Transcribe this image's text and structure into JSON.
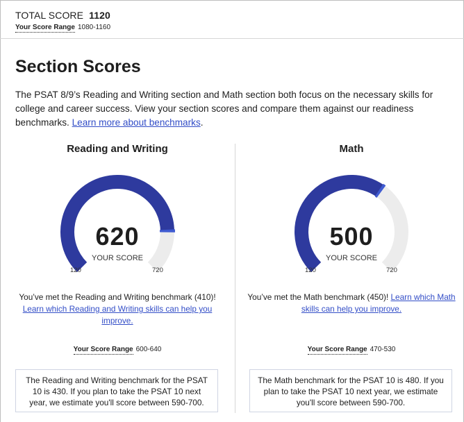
{
  "header": {
    "total_label": "TOTAL SCORE",
    "total_value": "1120",
    "range_label": "Your Score Range",
    "range_value": "1080-1160"
  },
  "page": {
    "title": "Section Scores",
    "intro_text": "The PSAT 8/9’s Reading and Writing section and Math section both focus on the necessary skills for college and career success. View your section scores and compare them against our readiness benchmarks. ",
    "intro_link": "Learn more about benchmarks",
    "intro_end": "."
  },
  "colors": {
    "accent": "#2e3a9e",
    "track": "#ececec",
    "marker": "#3f5bd1",
    "link": "#324dc7"
  },
  "sections": {
    "rw": {
      "title": "Reading and Writing",
      "score": "620",
      "score_num": 620,
      "score_label": "YOUR SCORE",
      "min": "120",
      "max": "720",
      "min_num": 120,
      "max_num": 720,
      "benchmark_num": 410,
      "msg_text": "You’ve met the Reading and Writing benchmark (410)! ",
      "msg_link": "Learn which Reading and Writing skills can help you improve.",
      "range_label": "Your Score Range",
      "range_value": "600-640",
      "note": "The Reading and Writing benchmark for the PSAT 10 is 430. If you plan to take the PSAT 10 next year, we estimate you'll score between 590-700."
    },
    "math": {
      "title": "Math",
      "score": "500",
      "score_num": 500,
      "score_label": "YOUR SCORE",
      "min": "120",
      "max": "720",
      "min_num": 120,
      "max_num": 720,
      "benchmark_num": 450,
      "msg_text": "You’ve met the Math benchmark (450)! ",
      "msg_link": "Learn which Math skills can help you improve.",
      "range_label": "Your Score Range",
      "range_value": "470-530",
      "note": "The Math benchmark for the PSAT 10 is 480. If you plan to take the PSAT 10 next year, we estimate you'll score between 590-700."
    }
  }
}
